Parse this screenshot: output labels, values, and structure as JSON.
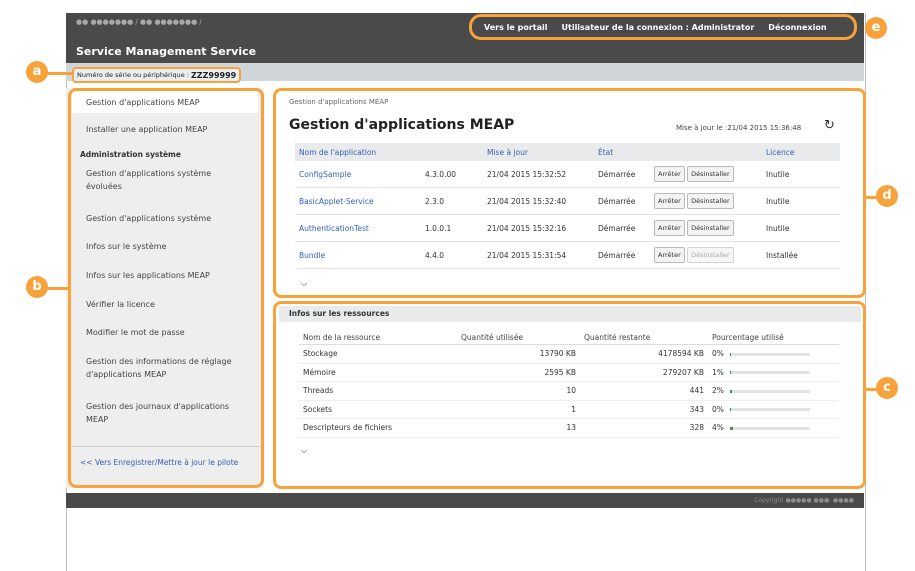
{
  "header": {
    "breadcrumb_blurred": "●● ●●●●●●● / ●● ●●●●●●● /",
    "app_title": "Service Management Service",
    "links": {
      "portal": "Vers le portail",
      "login_user": "Utilisateur de la connexion : Administrator",
      "logout": "Déconnexion"
    }
  },
  "serial": {
    "label": "Numéro de série ou périphérique :",
    "value": "ZZZ99999"
  },
  "sidebar": {
    "items": [
      "Gestion d'applications MEAP",
      "Installer une application MEAP",
      "Administration système",
      "Gestion d'applications système évoluées",
      "Gestion d'applications système",
      "Infos sur le système",
      "Infos sur les applications MEAP",
      "Vérifier la licence",
      "Modifier le mot de passe",
      "Gestion des informations de réglage d'applications MEAP",
      "Gestion des journaux d'applications MEAP"
    ],
    "back_link": "<< Vers Enregistrer/Mettre à jour le pilote"
  },
  "main": {
    "crumb": "Gestion d'applications MEAP",
    "title": "Gestion d'applications MEAP",
    "updated": "Mise à jour le :21/04 2015 15:36:48",
    "columns": {
      "name": "Nom de l'application",
      "update": "Mise à jour",
      "state": "État",
      "license": "Licence"
    },
    "apps": [
      {
        "name": "ConfigSample",
        "version": "4.3.0.00",
        "updated": "21/04 2015 15:32:52",
        "state": "Démarrée",
        "stop": "Arrêter",
        "uninstall": "Désinstaller",
        "license": "Inutile"
      },
      {
        "name": "BasicApplet-Service",
        "version": "2.3.0",
        "updated": "21/04 2015 15:32:40",
        "state": "Démarrée",
        "stop": "Arrêter",
        "uninstall": "Désinstaller",
        "license": "Inutile"
      },
      {
        "name": "AuthenticationTest",
        "version": "1.0.0.1",
        "updated": "21/04 2015 15:32:16",
        "state": "Démarrée",
        "stop": "Arrêter",
        "uninstall": "Désinstaller",
        "license": "Inutile"
      },
      {
        "name": "Bundle",
        "version": "4.4.0",
        "updated": "21/04 2015 15:31:54",
        "state": "Démarrée",
        "stop": "Arrêter",
        "uninstall": "Désinstaller",
        "license": "Installée"
      }
    ],
    "collapse_glyph": "⌵"
  },
  "resources": {
    "title": "Infos sur les ressources",
    "columns": {
      "name": "Nom de la ressource",
      "used": "Quantité utilisée",
      "remaining": "Quantité restante",
      "percent": "Pourcentage utilisé"
    },
    "rows": [
      {
        "name": "Stockage",
        "used": "13790 KB",
        "remaining": "4178594 KB",
        "percent_label": "0%",
        "percent": 0
      },
      {
        "name": "Mémoire",
        "used": "2595 KB",
        "remaining": "279207 KB",
        "percent_label": "1%",
        "percent": 1
      },
      {
        "name": "Threads",
        "used": "10",
        "remaining": "441",
        "percent_label": "2%",
        "percent": 2
      },
      {
        "name": "Sockets",
        "used": "1",
        "remaining": "343",
        "percent_label": "0%",
        "percent": 0
      },
      {
        "name": "Descripteurs de fichiers",
        "used": "13",
        "remaining": "328",
        "percent_label": "4%",
        "percent": 4
      }
    ]
  },
  "footer": {
    "copyright_blurred": "Copyright ●●●●● ●●●. ●●●●"
  },
  "callouts": {
    "a": "a",
    "b": "b",
    "c": "c",
    "d": "d",
    "e": "e"
  },
  "colors": {
    "accent": "#f7a23b",
    "header": "#4a4a4a",
    "link": "#3361b3",
    "progress": "#2e9e4a"
  }
}
